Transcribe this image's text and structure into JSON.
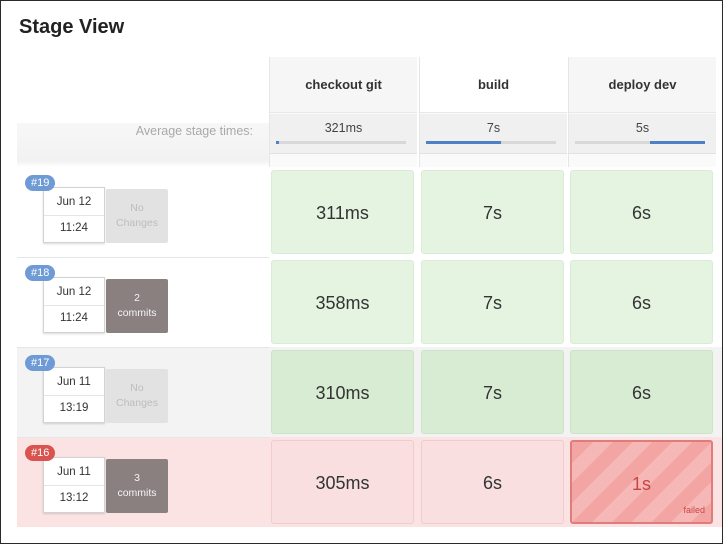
{
  "title": "Stage View",
  "avg_label": "Average stage times:",
  "stages": [
    {
      "name": "checkout git",
      "avg": "321ms",
      "bar_start": 0.0,
      "bar_end": 0.02
    },
    {
      "name": "build",
      "avg": "7s",
      "bar_start": 0.0,
      "bar_end": 0.58
    },
    {
      "name": "deploy dev",
      "avg": "5s",
      "bar_start": 0.58,
      "bar_end": 1.0
    }
  ],
  "runs": [
    {
      "badge": "#19",
      "date": "Jun 12",
      "time": "11:24",
      "changes_line1": "No",
      "changes_line2": "Changes",
      "cells": [
        "311ms",
        "7s",
        "6s"
      ]
    },
    {
      "badge": "#18",
      "date": "Jun 12",
      "time": "11:24",
      "changes_line1": "2",
      "changes_line2": "commits",
      "cells": [
        "358ms",
        "7s",
        "6s"
      ]
    },
    {
      "badge": "#17",
      "date": "Jun 11",
      "time": "13:19",
      "changes_line1": "No",
      "changes_line2": "Changes",
      "cells": [
        "310ms",
        "7s",
        "6s"
      ]
    },
    {
      "badge": "#16",
      "date": "Jun 11",
      "time": "13:12",
      "changes_line1": "3",
      "changes_line2": "commits",
      "cells": [
        "305ms",
        "6s",
        "1s"
      ],
      "failed_label": "failed"
    }
  ]
}
